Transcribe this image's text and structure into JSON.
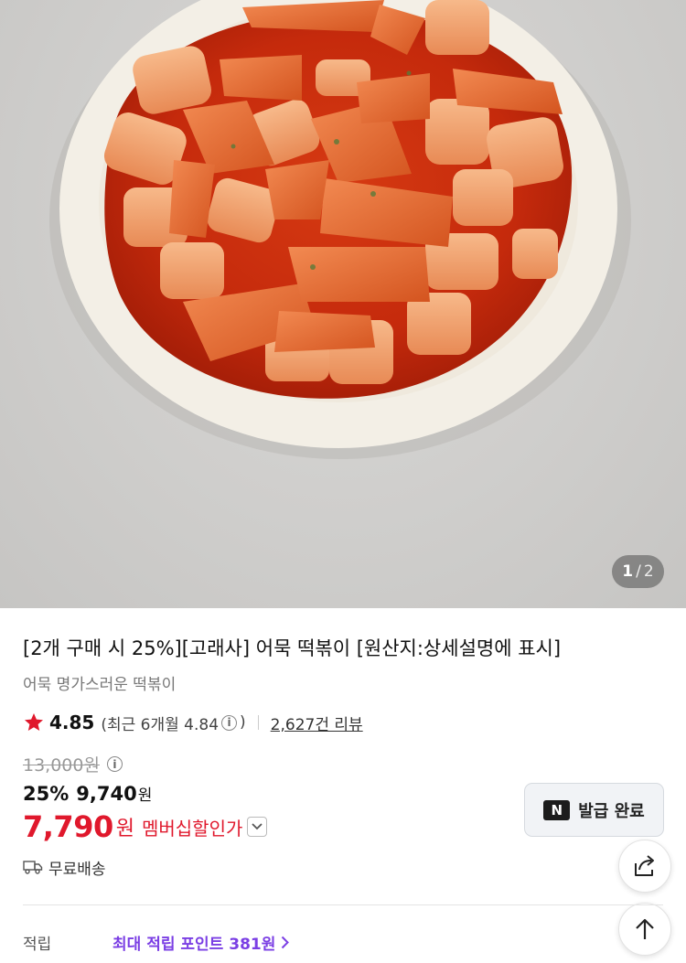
{
  "gallery": {
    "current": "1",
    "separator": "/",
    "total": "2"
  },
  "product": {
    "title": "[2개 구매 시 25%][고래사] 어묵 떡볶이 [원산지:상세설명에 표시]",
    "subtitle": "어묵 명가스러운 떡볶이"
  },
  "rating": {
    "score": "4.85",
    "recent_prefix": "(최근 6개월 4.84",
    "recent_suffix": ")",
    "review_link": "2,627건 리뷰"
  },
  "price": {
    "original": "13,000원",
    "discount_percent": "25%",
    "sale_value": "9,740",
    "sale_unit": "원",
    "member_value": "7,790",
    "member_unit": "원",
    "member_label": "멤버십할인가"
  },
  "coupon": {
    "logo_text": "N",
    "label": "발급 완료"
  },
  "shipping": {
    "label": "무료배송"
  },
  "points": {
    "label": "적립",
    "value": "최대 적립 포인트 381원"
  },
  "colors": {
    "member_red": "#e0182c",
    "points_purple": "#7b3fe4",
    "star_red": "#e0182c"
  },
  "icons": [
    "star-icon",
    "info-icon",
    "chevron-down-icon",
    "truck-icon",
    "share-icon",
    "arrow-up-icon",
    "chevron-right-icon"
  ]
}
